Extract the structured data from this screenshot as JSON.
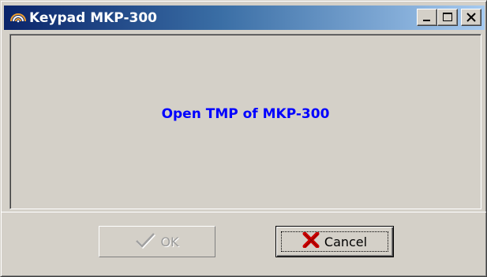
{
  "window": {
    "title": "Keypad MKP-300",
    "app_icon": "signal-waves-icon",
    "title_buttons": [
      "minimize-icon",
      "maximize-icon",
      "close-icon"
    ]
  },
  "message": {
    "text": "Open TMP of MKP-300",
    "color": "#0000ff"
  },
  "buttons": {
    "ok_label": "OK",
    "ok_icon": "checkmark-icon",
    "ok_enabled": false,
    "cancel_label": "Cancel",
    "cancel_icon": "red-x-icon",
    "cancel_focused": true
  },
  "colors": {
    "title_gradient_start": "#0a246a",
    "title_gradient_end": "#a6caf0",
    "face": "#d4d0c8",
    "cancel_x": "#cc0000"
  }
}
